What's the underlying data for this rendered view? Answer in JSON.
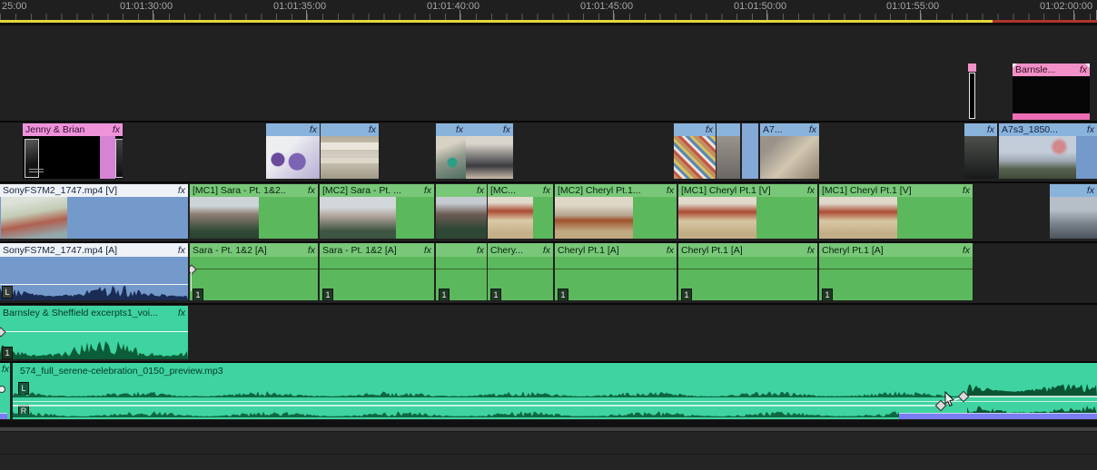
{
  "app": {
    "name": "video editing timeline"
  },
  "ruler": {
    "labels": [
      "25:00",
      "01:01:30:00",
      "01:01:35:00",
      "01:01:40:00",
      "01:01:45:00",
      "01:01:50:00",
      "01:01:55:00",
      "01:02:00:00"
    ]
  },
  "icons": {
    "fx": "fx"
  },
  "badges": {
    "one": "1",
    "left": "L",
    "right": "R"
  },
  "colors": {
    "render_bar_yellow": "#e3d93c",
    "render_bar_red": "#ae352b",
    "clip_blue": "#7499cb",
    "clip_blue_hdr": "#8ab3dc",
    "clip_green": "#5cb85c",
    "clip_green_hdr": "#79c779",
    "clip_teal": "#3ed3a0",
    "clip_pink_hdr": "#f291c8",
    "clip_pink_bar": "#ef6db5",
    "clip_magenta": "#ee93da",
    "selected_hdr": "#eef2f6",
    "music_bar_blue": "#7a7cf2"
  },
  "clips": {
    "barnsle": {
      "label": "Barnsle..."
    },
    "jenny_brian": {
      "label": "Jenny & Brian"
    },
    "a7": {
      "label": "A7..."
    },
    "a7s3": {
      "label": "A7s3_1850..."
    },
    "sony_v": {
      "label": "SonyFS7M2_1747.mp4 [V]"
    },
    "mc1_sara": {
      "label": "[MC1] Sara - Pt. 1&2.."
    },
    "mc2_sara": {
      "label": "[MC2] Sara - Pt. ..."
    },
    "mc_trunc": {
      "label": "[MC..."
    },
    "mc2_cheryl": {
      "label": "[MC2] Cheryl Pt.1..."
    },
    "mc1_cheryl": {
      "label": "[MC1] Cheryl Pt.1 [V]"
    },
    "sony_a": {
      "label": "SonyFS7M2_1747.mp4 [A]"
    },
    "sara_a": {
      "label": "Sara - Pt. 1&2 [A]"
    },
    "cheryl_trunc": {
      "label": "Chery..."
    },
    "cheryl_a": {
      "label": "Cheryl Pt.1 [A]"
    },
    "barnsley_vo": {
      "label": "Barnsley & Sheffield excerpts1_voi..."
    },
    "music": {
      "label": "574_full_serene-celebration_0150_preview.mp3"
    }
  }
}
